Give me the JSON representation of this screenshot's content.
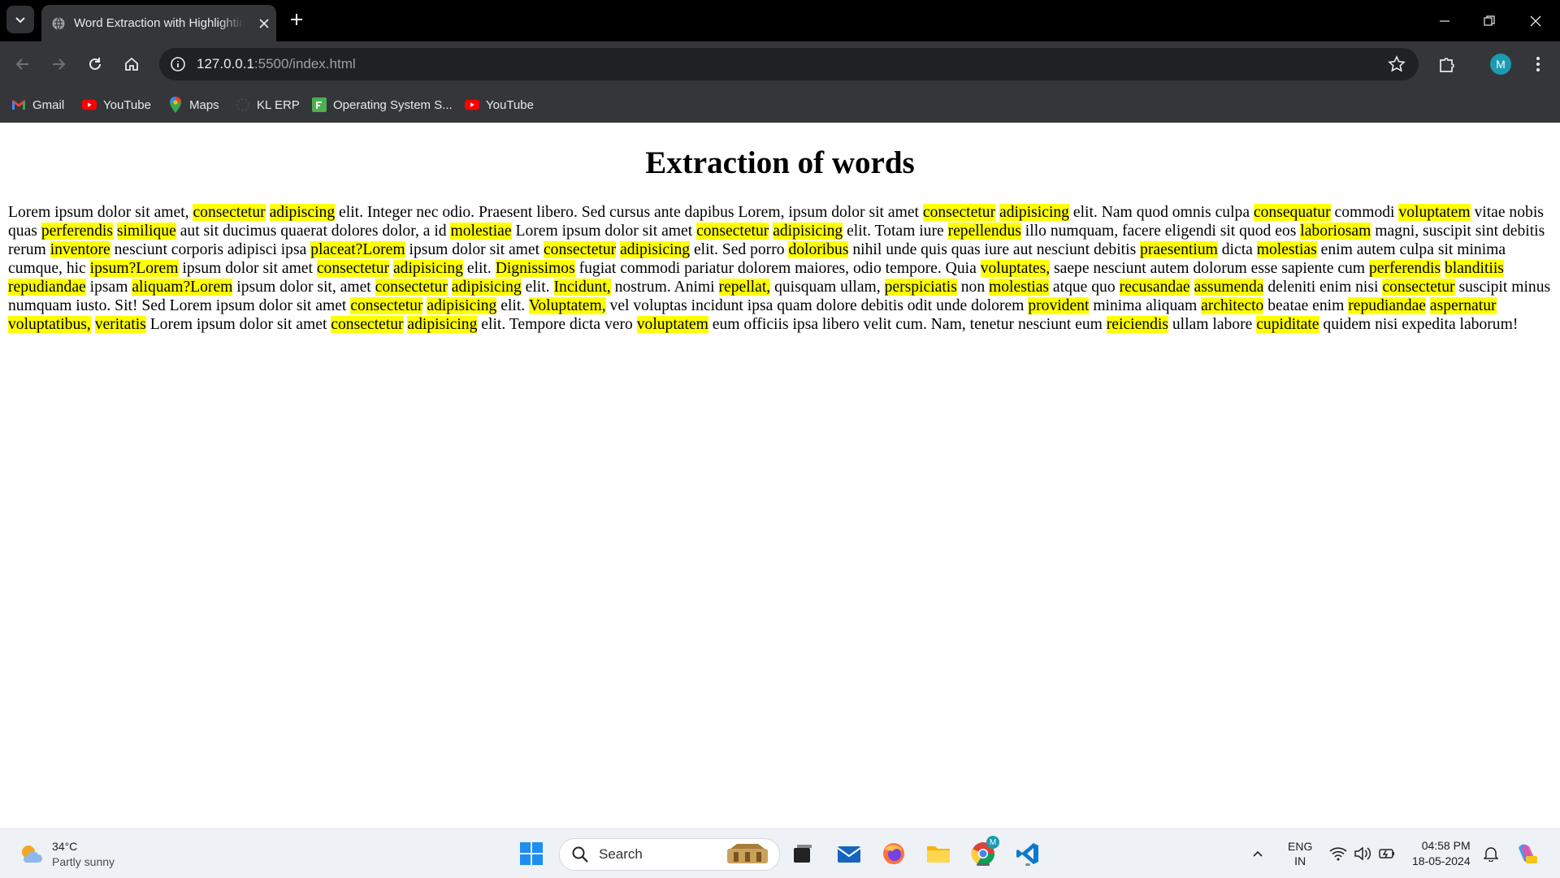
{
  "browser": {
    "tab_title": "Word Extraction with Highlighting",
    "url_host": "127.0.0.1",
    "url_path": ":5500/index.html",
    "profile_initial": "M"
  },
  "bookmarks": [
    {
      "label": "Gmail",
      "icon": "gmail-icon"
    },
    {
      "label": "YouTube",
      "icon": "youtube-icon"
    },
    {
      "label": "Maps",
      "icon": "maps-icon"
    },
    {
      "label": "KL ERP",
      "icon": "kl-erp-icon"
    },
    {
      "label": "Operating System S...",
      "icon": "os-icon"
    },
    {
      "label": "YouTube",
      "icon": "youtube-icon"
    }
  ],
  "page": {
    "heading": "Extraction of words",
    "highlight_color": "#ffff00",
    "paragraph": [
      "Lorem ipsum dolor sit amet, ",
      {
        "h": "consectetur"
      },
      " ",
      {
        "h": "adipiscing"
      },
      " elit. Integer nec odio. Praesent libero. Sed cursus ante dapibus Lorem, ipsum dolor sit amet ",
      {
        "h": "consectetur"
      },
      " ",
      {
        "h": "adipisicing"
      },
      " elit. Nam quod omnis culpa ",
      {
        "h": "consequatur"
      },
      " commodi ",
      {
        "h": "voluptatem"
      },
      " vitae nobis quas ",
      {
        "h": "perferendis"
      },
      " ",
      {
        "h": "similique"
      },
      " aut sit ducimus quaerat dolores dolor, a id ",
      {
        "h": "molestiae"
      },
      " Lorem ipsum dolor sit amet ",
      {
        "h": "consectetur"
      },
      " ",
      {
        "h": "adipisicing"
      },
      " elit. Totam iure ",
      {
        "h": "repellendus"
      },
      " illo numquam, facere eligendi sit quod eos ",
      {
        "h": "laboriosam"
      },
      " magni, suscipit sint debitis rerum ",
      {
        "h": "inventore"
      },
      " nesciunt corporis adipisci ipsa ",
      {
        "h": "placeat?Lorem"
      },
      " ipsum dolor sit amet ",
      {
        "h": "consectetur"
      },
      " ",
      {
        "h": "adipisicing"
      },
      " elit. Sed porro ",
      {
        "h": "doloribus"
      },
      " nihil unde quis quas iure aut nesciunt debitis ",
      {
        "h": "praesentium"
      },
      " dicta ",
      {
        "h": "molestias"
      },
      " enim autem culpa sit minima cumque, hic ",
      {
        "h": "ipsum?Lorem"
      },
      " ipsum dolor sit amet ",
      {
        "h": "consectetur"
      },
      " ",
      {
        "h": "adipisicing"
      },
      " elit. ",
      {
        "h": "Dignissimos"
      },
      " fugiat commodi pariatur dolorem maiores, odio tempore. Quia ",
      {
        "h": "voluptates,"
      },
      " saepe nesciunt autem dolorum esse sapiente cum ",
      {
        "h": "perferendis"
      },
      " ",
      {
        "h": "blanditiis"
      },
      " ",
      {
        "h": "repudiandae"
      },
      " ipsam ",
      {
        "h": "aliquam?Lorem"
      },
      " ipsum dolor sit, amet ",
      {
        "h": "consectetur"
      },
      " ",
      {
        "h": "adipisicing"
      },
      " elit. ",
      {
        "h": "Incidunt,"
      },
      " nostrum. Animi ",
      {
        "h": "repellat,"
      },
      " quisquam ullam, ",
      {
        "h": "perspiciatis"
      },
      " non ",
      {
        "h": "molestias"
      },
      " atque quo ",
      {
        "h": "recusandae"
      },
      " ",
      {
        "h": "assumenda"
      },
      " deleniti enim nisi ",
      {
        "h": "consectetur"
      },
      " suscipit minus numquam iusto. Sit! Sed Lorem ipsum dolor sit amet ",
      {
        "h": "consectetur"
      },
      " ",
      {
        "h": "adipisicing"
      },
      " elit. ",
      {
        "h": "Voluptatem,"
      },
      " vel voluptas incidunt ipsa quam dolore debitis odit unde dolorem ",
      {
        "h": "provident"
      },
      " minima aliquam ",
      {
        "h": "architecto"
      },
      " beatae enim ",
      {
        "h": "repudiandae"
      },
      " ",
      {
        "h": "aspernatur"
      },
      " ",
      {
        "h": "voluptatibus,"
      },
      " ",
      {
        "h": "veritatis"
      },
      " Lorem ipsum dolor sit amet ",
      {
        "h": "consectetur"
      },
      " ",
      {
        "h": "adipisicing"
      },
      " elit. Tempore dicta vero ",
      {
        "h": "voluptatem"
      },
      " eum officiis ipsa libero velit cum. Nam, tenetur nesciunt eum ",
      {
        "h": "reiciendis"
      },
      " ullam labore ",
      {
        "h": "cupiditate"
      },
      " quidem nisi expedita laborum!"
    ]
  },
  "taskbar": {
    "weather_temp": "34°C",
    "weather_condition": "Partly sunny",
    "search_placeholder": "Search",
    "lang_top": "ENG",
    "lang_bottom": "IN",
    "time": "04:58 PM",
    "date": "18-05-2024",
    "chrome_badge": "M"
  }
}
